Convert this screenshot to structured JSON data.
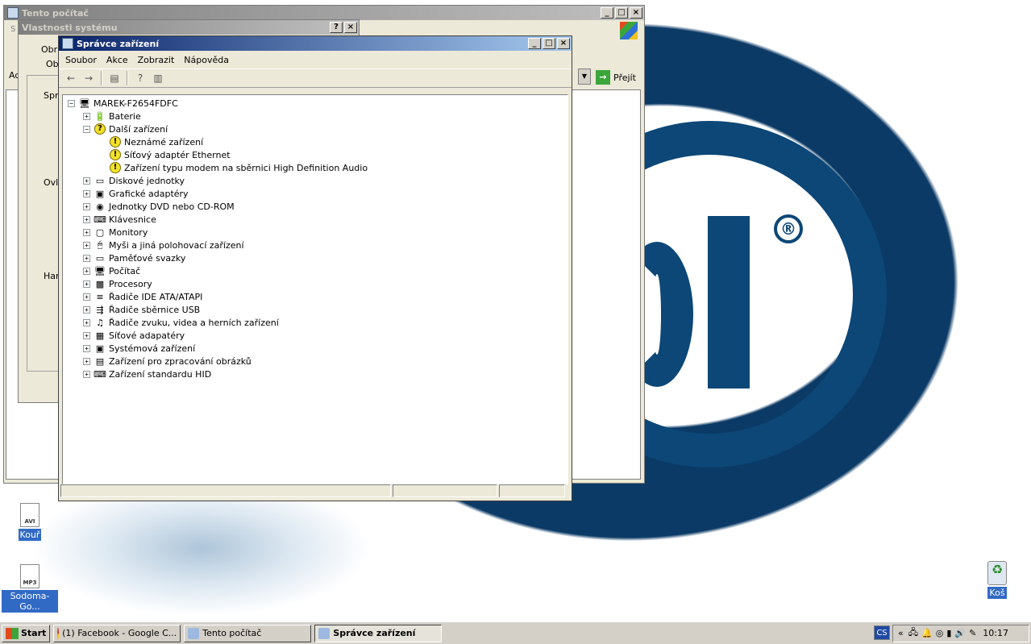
{
  "desktop": {
    "icons": [
      {
        "label": "Kouř",
        "ext": "AVI"
      },
      {
        "label": "Sodoma-Go...",
        "ext": "MP3"
      },
      {
        "label": "Koš"
      }
    ]
  },
  "window_computer": {
    "title": "Tento počítač",
    "go_label": "Přejít",
    "menu_partial": "S",
    "addr_partial": "Ad"
  },
  "window_props": {
    "title": "Vlastnosti systému",
    "tab1": "Obr",
    "tab2": "Ob",
    "group1": "Spr",
    "group2": "Ovl",
    "group3": "Har"
  },
  "device_manager": {
    "title": "Správce zařízení",
    "menu": [
      "Soubor",
      "Akce",
      "Zobrazit",
      "Nápověda"
    ],
    "root": "MAREK-F2654FDFC",
    "items": [
      {
        "label": "Baterie",
        "icon": "battery-icon"
      },
      {
        "label": "Další zařízení",
        "icon": "unknown-device-icon",
        "expanded": true,
        "children": [
          "Neznámé zařízení",
          "Síťový adaptér Ethernet",
          "Zařízení typu modem na sběrnici High Definition Audio"
        ]
      },
      {
        "label": "Diskové jednotky",
        "icon": "disk-icon"
      },
      {
        "label": "Grafické adaptéry",
        "icon": "display-adapter-icon"
      },
      {
        "label": "Jednotky DVD nebo CD-ROM",
        "icon": "cdrom-icon"
      },
      {
        "label": "Klávesnice",
        "icon": "keyboard-icon"
      },
      {
        "label": "Monitory",
        "icon": "monitor-icon"
      },
      {
        "label": "Myši a jiná polohovací zařízení",
        "icon": "mouse-icon"
      },
      {
        "label": "Paměťové svazky",
        "icon": "storage-volume-icon"
      },
      {
        "label": "Počítač",
        "icon": "computer-icon"
      },
      {
        "label": "Procesory",
        "icon": "processor-icon"
      },
      {
        "label": "Řadiče IDE ATA/ATAPI",
        "icon": "ide-controller-icon"
      },
      {
        "label": "Řadiče sběrnice USB",
        "icon": "usb-icon"
      },
      {
        "label": "Řadiče zvuku, videa a herních zařízení",
        "icon": "sound-icon"
      },
      {
        "label": "Síťové adapatéry",
        "icon": "network-adapter-icon"
      },
      {
        "label": "Systémová zařízení",
        "icon": "system-device-icon"
      },
      {
        "label": "Zařízení pro zpracování obrázků",
        "icon": "imaging-device-icon"
      },
      {
        "label": "Zařízení standardu HID",
        "icon": "hid-icon"
      }
    ]
  },
  "taskbar": {
    "start": "Start",
    "tasks": [
      "(1) Facebook - Google C...",
      "Tento počítač",
      "Správce zařízení"
    ],
    "lang": "CS",
    "clock": "10:17",
    "tray_chevron": "«"
  }
}
